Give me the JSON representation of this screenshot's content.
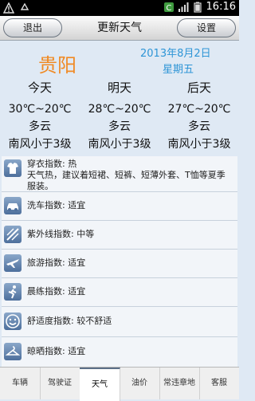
{
  "statusbar": {
    "time": "16:16",
    "icons": [
      "warning-icon",
      "recycle-icon",
      "app-c-icon",
      "signal-icon",
      "battery-icon"
    ]
  },
  "header": {
    "back_label": "退出",
    "title": "更新天气",
    "settings_label": "设置"
  },
  "weather": {
    "city": "贵阳",
    "date": "2013年8月2日",
    "weekday": "星期五",
    "days": [
      {
        "name": "今天",
        "temp": "30℃~20℃",
        "condition": "多云",
        "wind": "南风小于3级"
      },
      {
        "name": "明天",
        "temp": "28℃~20℃",
        "condition": "多云",
        "wind": "南风小于3级"
      },
      {
        "name": "后天",
        "temp": "27℃~20℃",
        "condition": "多云",
        "wind": "南风小于3级"
      }
    ]
  },
  "indices": [
    {
      "label": "穿衣指数: 热",
      "desc": "天气热，建议着短裙、短裤、短薄外套、T恤等夏季服装。",
      "icon": "shirt-icon"
    },
    {
      "label": "洗车指数: 适宜",
      "desc": "",
      "icon": "car-icon"
    },
    {
      "label": "紫外线指数: 中等",
      "desc": "",
      "icon": "uv-icon"
    },
    {
      "label": "旅游指数: 适宜",
      "desc": "",
      "icon": "plane-icon"
    },
    {
      "label": "晨练指数: 适宜",
      "desc": "",
      "icon": "runner-icon"
    },
    {
      "label": "舒适度指数: 较不舒适",
      "desc": "",
      "icon": "smile-icon"
    },
    {
      "label": "晾晒指数: 适宜",
      "desc": "",
      "icon": "hanger-icon"
    }
  ],
  "tabs": [
    {
      "label": "车辆"
    },
    {
      "label": "驾驶证"
    },
    {
      "label": "天气"
    },
    {
      "label": "油价"
    },
    {
      "label": "常违章地"
    },
    {
      "label": "客服"
    }
  ]
}
